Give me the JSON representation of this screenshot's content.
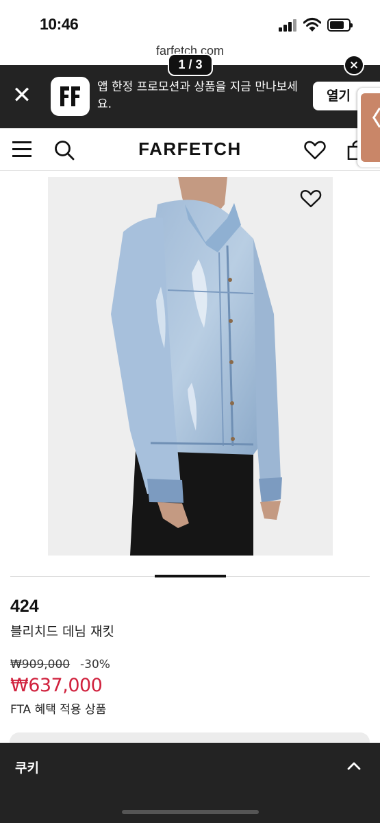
{
  "status_bar": {
    "time": "10:46"
  },
  "browser": {
    "url": "farfetch.com"
  },
  "app_banner": {
    "message": "앱 한정 프로모션과 상품을 지금 만나보세요.",
    "open_label": "열기",
    "close_symbol": "✕",
    "icon": "farfetch-app-icon"
  },
  "overlay": {
    "page_counter": "1 / 3",
    "dismiss_symbol": "×",
    "side_tab_symbol": "〈"
  },
  "nav": {
    "brand": "FARFETCH",
    "icons": [
      "menu-icon",
      "search-icon",
      "heart-icon",
      "bag-icon"
    ]
  },
  "product": {
    "brand": "424",
    "name": "블리치드 데님 재킷",
    "original_price": "₩909,000",
    "discount": "-30%",
    "sale_price": "₩637,000",
    "fta_note": "FTA 혜택 적용 상품",
    "image_index": 1,
    "image_count": 3
  },
  "cookie_bar": {
    "label": "쿠키"
  },
  "colors": {
    "banner_bg": "#232323",
    "sale_red": "#d0213d",
    "text": "#111111"
  }
}
